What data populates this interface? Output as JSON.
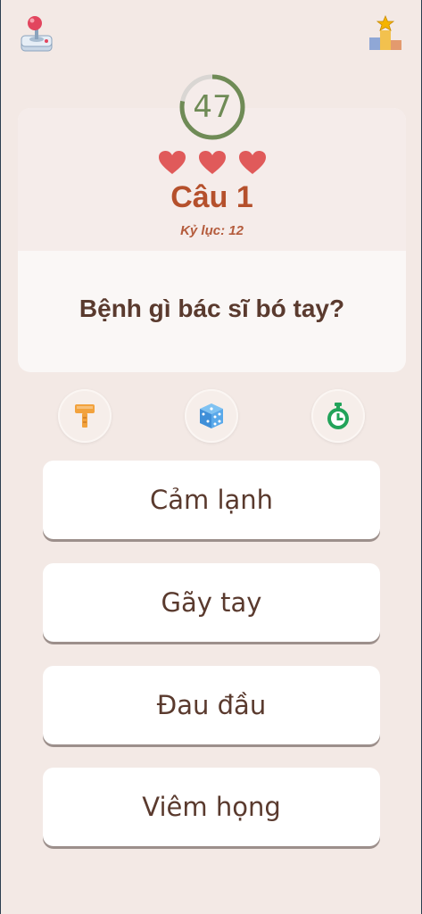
{
  "header": {
    "left_icon": "joystick-icon",
    "right_icon": "podium-trophy-icon"
  },
  "timer": {
    "value": "47",
    "progress": 0.78,
    "color": "#6f8b56"
  },
  "lives": {
    "count": 3,
    "color": "#e05a5a"
  },
  "question": {
    "number_label": "Câu 1",
    "record_label": "Kỷ lục: 12",
    "text": "Bệnh gì bác sĩ bó tay?"
  },
  "powerups": [
    {
      "icon": "hammer-icon"
    },
    {
      "icon": "dice-icon"
    },
    {
      "icon": "stopwatch-icon"
    }
  ],
  "answers": [
    {
      "label": "Cảm lạnh"
    },
    {
      "label": "Gãy tay"
    },
    {
      "label": "Đau đầu"
    },
    {
      "label": "Viêm họng"
    }
  ],
  "colors": {
    "background": "#f3e9e5",
    "accent": "#b5502c",
    "text": "#5a3a2e"
  }
}
